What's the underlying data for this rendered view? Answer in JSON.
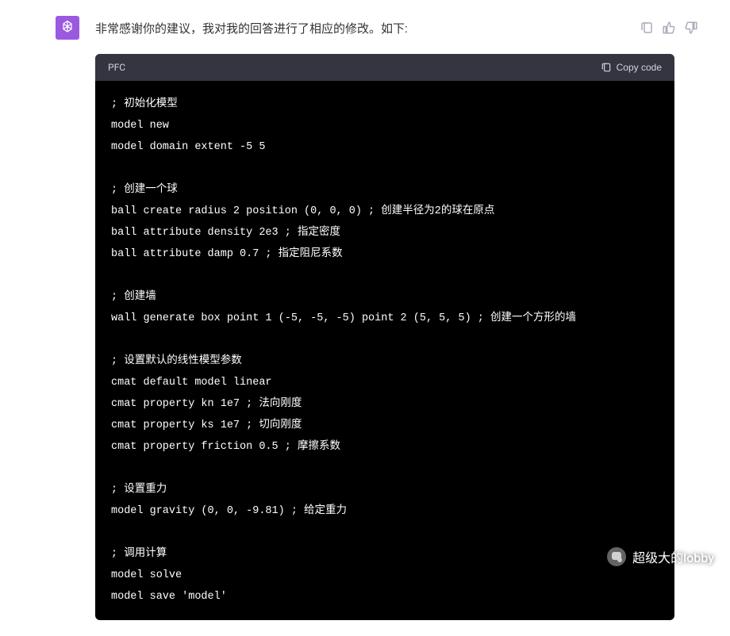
{
  "message": {
    "text": "非常感谢你的建议，我对我的回答进行了相应的修改。如下:"
  },
  "code_block": {
    "language": "PFC",
    "copy_label": "Copy code",
    "content": "; 初始化模型\nmodel new\nmodel domain extent -5 5\n\n; 创建一个球\nball create radius 2 position (0, 0, 0) ; 创建半径为2的球在原点\nball attribute density 2e3 ; 指定密度\nball attribute damp 0.7 ; 指定阻尼系数\n\n; 创建墙\nwall generate box point 1 (-5, -5, -5) point 2 (5, 5, 5) ; 创建一个方形的墙\n\n; 设置默认的线性模型参数\ncmat default model linear\ncmat property kn 1e7 ; 法向刚度\ncmat property ks 1e7 ; 切向刚度\ncmat property friction 0.5 ; 摩擦系数\n\n; 设置重力\nmodel gravity (0, 0, -9.81) ; 给定重力\n\n; 调用计算\nmodel solve\nmodel save 'model'"
  },
  "watermark": {
    "text": "超级大的lobby"
  }
}
